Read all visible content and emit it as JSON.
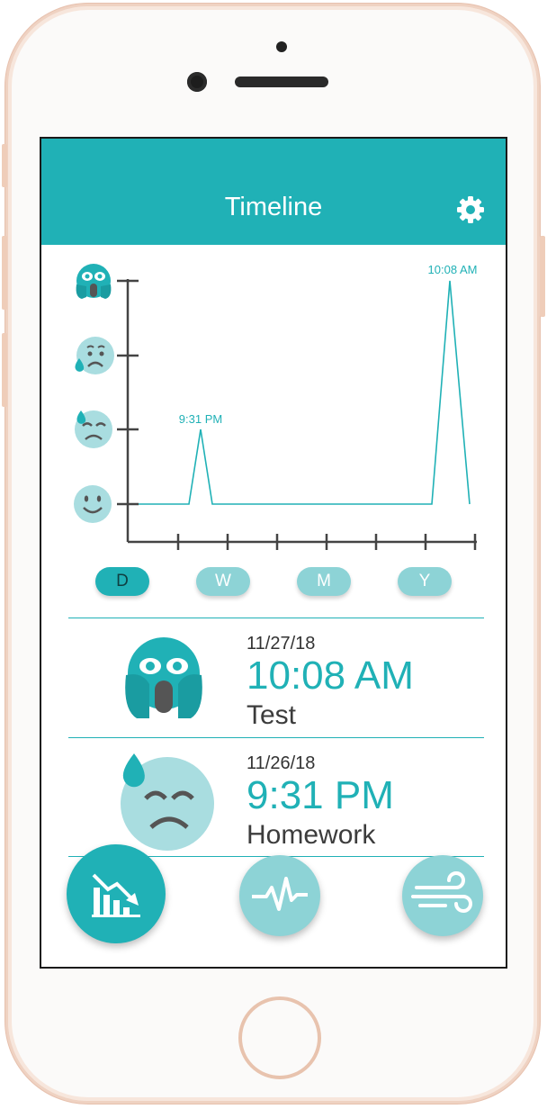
{
  "header": {
    "title": "Timeline"
  },
  "chart": {
    "y_levels": [
      "screaming-face",
      "sad-sweat-face",
      "downcast-sweat-face",
      "smiling-face"
    ],
    "peak_labels": [
      "9:31 PM",
      "10:08 AM"
    ]
  },
  "range_tabs": {
    "selected": "D",
    "items": [
      "D",
      "W",
      "M",
      "Y"
    ]
  },
  "entries": [
    {
      "date": "11/27/18",
      "time": "10:08 AM",
      "label": "Test",
      "icon": "screaming-face"
    },
    {
      "date": "11/26/18",
      "time": "9:31 PM",
      "label": "Homework",
      "icon": "downcast-sweat-face"
    }
  ],
  "bottom_nav": {
    "items": [
      "timeline-chart-icon",
      "heartbeat-icon",
      "wind-icon"
    ],
    "active": "timeline-chart-icon"
  },
  "colors": {
    "accent": "#20b1b6",
    "light_accent": "#8dd3d6",
    "face": "#a9dde0"
  }
}
